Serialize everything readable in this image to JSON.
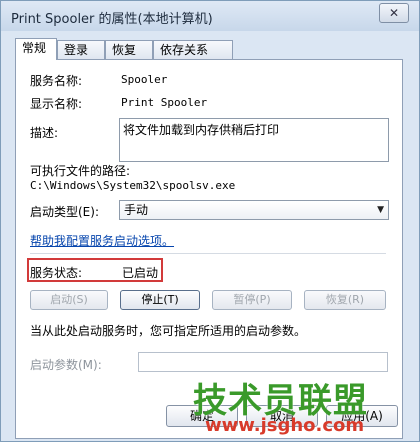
{
  "window": {
    "title": "Print Spooler 的属性(本地计算机)",
    "close_label": "✕"
  },
  "tabs": [
    {
      "label": "常规"
    },
    {
      "label": "登录"
    },
    {
      "label": "恢复"
    },
    {
      "label": "依存关系"
    }
  ],
  "general": {
    "service_name_label": "服务名称:",
    "service_name": "Spooler",
    "display_name_label": "显示名称:",
    "display_name": "Print Spooler",
    "description_label": "描述:",
    "description": "将文件加载到内存供稍后打印",
    "path_label": "可执行文件的路径:",
    "path": "C:\\Windows\\System32\\spoolsv.exe",
    "startup_type_label": "启动类型(E):",
    "startup_type": "手动",
    "help_link": "帮助我配置服务启动选项。",
    "status_label": "服务状态:",
    "status_value": "已启动",
    "buttons": {
      "start": "启动(S)",
      "stop": "停止(T)",
      "pause": "暂停(P)",
      "resume": "恢复(R)"
    },
    "hint": "当从此处启动服务时，您可指定所适用的启动参数。",
    "param_label": "启动参数(M):",
    "param_value": ""
  },
  "dialog_buttons": {
    "ok": "确定",
    "cancel": "取消",
    "apply": "应用(A)"
  },
  "watermark": {
    "brand": "技术员联盟",
    "url": "www.jsgho.com"
  },
  "colors": {
    "highlight_border": "#d23a3a",
    "link": "#0645ad"
  }
}
